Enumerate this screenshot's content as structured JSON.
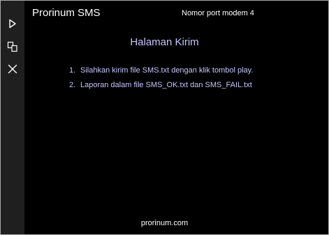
{
  "app": {
    "title": "Prorinum SMS",
    "port_label": "Nomor port modem 4"
  },
  "sidebar": {
    "buttons": [
      {
        "icon": "play-icon"
      },
      {
        "icon": "copy-icon"
      },
      {
        "icon": "close-icon"
      }
    ]
  },
  "main": {
    "heading": "Halaman Kirim",
    "instructions": [
      {
        "num": "1.",
        "text": "Silahkan kirim file SMS.txt dengan klik tombol play."
      },
      {
        "num": "2.",
        "text": "Laporan dalam file SMS_OK.txt dan SMS_FAIL.txt"
      }
    ]
  },
  "footer": {
    "link": "prorinum.com"
  },
  "colors": {
    "background": "#000000",
    "sidebar": "#1f1f1f",
    "accent_text": "#c5c5ff",
    "text": "#ffffff"
  }
}
